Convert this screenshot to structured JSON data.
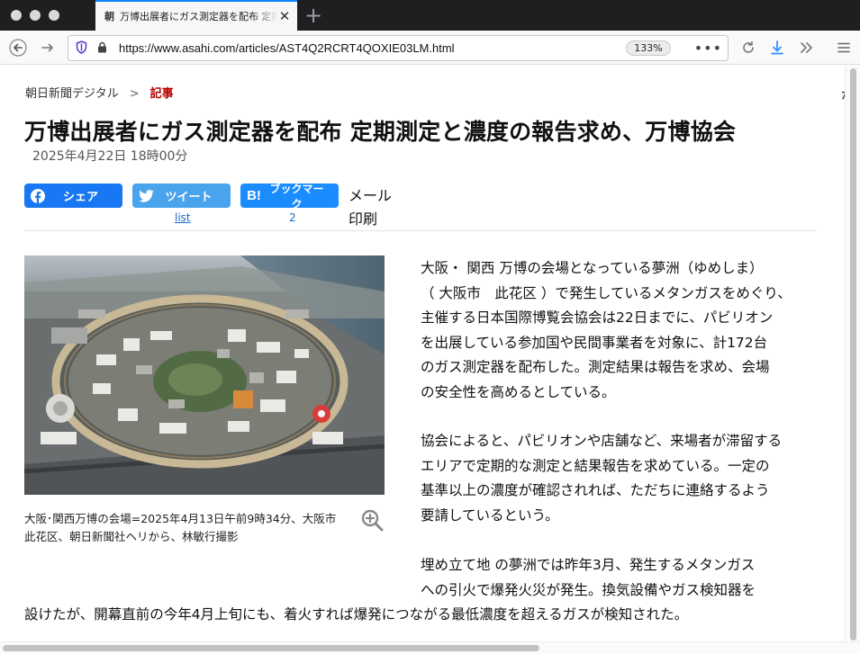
{
  "browser": {
    "tab": {
      "favicon": "朝",
      "title": "万博出展者にガス測定器を配布 定期測定と濃度の報告求め、万博協会",
      "close_glyph": "✕"
    },
    "new_tab_glyph": "+",
    "url": "https://www.asahi.com/articles/AST4Q2RCRT4QOXIE03LM.html",
    "zoom": "133%",
    "icons": {
      "back": "back-arrow-icon",
      "forward": "forward-arrow-icon",
      "shield": "tracking-shield-icon",
      "lock": "lock-icon",
      "more": "more-dots-icon",
      "reload": "reload-icon",
      "download": "download-icon",
      "overflow": "chevrons-icon",
      "menu": "hamburger-menu-icon"
    }
  },
  "article": {
    "breadcrumb": {
      "site": "朝日新聞デジタル",
      "separator": ">",
      "current": "記事"
    },
    "headline": "万博出展者にガス測定器を配布 定期測定と濃度の報告求め、万博協会",
    "date": "2025年4月22日 18時00分",
    "share": {
      "facebook_label": "シェア",
      "twitter_label": "ツイート",
      "twitter_count": "list",
      "hatena_label": "ブックマーク",
      "hatena_count": "2",
      "mail_label": "メール",
      "print_label": "印刷"
    },
    "photo_caption_lines": [
      "大阪･関西万博の会場=2025年4月13日午前9時34分、大阪市",
      "此花区、朝日新聞社ヘリから、林敏行撮影"
    ],
    "paragraph1_lines": [
      " 大阪・ 関西 万博の会場となっている夢洲（ゆめしま）",
      "（ 大阪市　此花区 ）で発生しているメタンガスをめぐり、",
      "主催する日本国際博覧会協会は22日までに、パビリオン",
      "を出展している参加国や民間事業者を対象に、計172台",
      "のガス測定器を配布した。測定結果は報告を求め、会場",
      "の安全性を高めるとしている。"
    ],
    "paragraph2_lines": [
      " 協会によると、パビリオンや店舗など、来場者が滞留する",
      "エリアで定期的な測定と結果報告を求めている。一定の",
      "基準以上の濃度が確認されれば、ただちに連絡するよう",
      "要請しているという。"
    ],
    "paragraph3_lines": [
      "  埋め立て地 の夢洲では昨年3月、発生するメタンガス",
      "への引火で爆発火災が発生。換気設備やガス検知器を"
    ],
    "paragraph3_full_line": "設けたが、開幕直前の今年4月上旬にも、着火すれば爆発につながる最低濃度を超えるガスが検知された。",
    "right_edge_glyph": "が"
  },
  "colors": {
    "facebook": "#1877f2",
    "twitter": "#4aa3ed",
    "hatena": "#1a8cff",
    "breadcrumb_current": "#b60000",
    "link": "#1a67c9"
  }
}
